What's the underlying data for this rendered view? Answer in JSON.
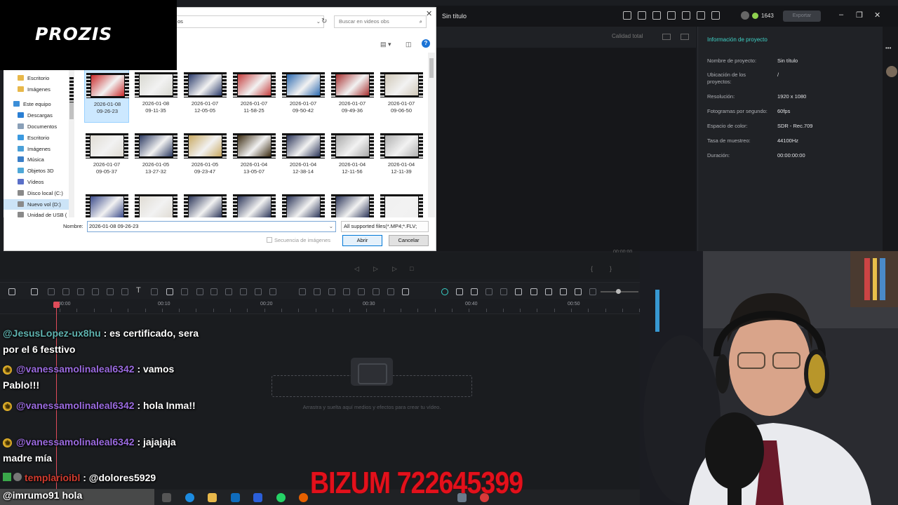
{
  "logo": {
    "text": "PROZIS"
  },
  "editor": {
    "title": "Sin título",
    "credits": "1643",
    "export_label": "Exportar",
    "quality_label": "Calidad total",
    "timecode": "00:00:00",
    "project_panel": {
      "title": "Información de proyecto",
      "rows": [
        {
          "key": "Nombre de proyecto:",
          "value": "Sin título"
        },
        {
          "key": "Ubicación de los proyectos:",
          "value": "/"
        },
        {
          "key": "Resolución:",
          "value": "1920 x 1080"
        },
        {
          "key": "Fotogramas por segundo:",
          "value": "60fps"
        },
        {
          "key": "Espacio de color:",
          "value": "SDR - Rec.709"
        },
        {
          "key": "Tasa de muestreo:",
          "value": "44100Hz"
        },
        {
          "key": "Duración:",
          "value": "00:00:00:00"
        }
      ]
    },
    "ruler_ticks": [
      "00:00",
      "00:10",
      "00:20",
      "00:30",
      "00:40",
      "00:50"
    ],
    "drop_hint": "Arrastra y suelta aquí medios y efectos para crear tu vídeo."
  },
  "dialog": {
    "path_fragment": "os",
    "search_placeholder": "Buscar en videos obs",
    "nav_items": [
      {
        "label": "Escritorio",
        "icon": "folder-icon",
        "color": "#e8b84a"
      },
      {
        "label": "Imágenes",
        "icon": "folder-icon",
        "color": "#e8b84a"
      },
      {
        "label": "Este equipo",
        "icon": "computer-icon",
        "color": "#3b8ed8"
      },
      {
        "label": "Descargas",
        "icon": "download-icon",
        "color": "#2a7fd4"
      },
      {
        "label": "Documentos",
        "icon": "document-icon",
        "color": "#8aa0b8"
      },
      {
        "label": "Escritorio",
        "icon": "desktop-icon",
        "color": "#3b9ae0"
      },
      {
        "label": "Imágenes",
        "icon": "pictures-icon",
        "color": "#4aa0d8"
      },
      {
        "label": "Música",
        "icon": "music-icon",
        "color": "#3a7fc8"
      },
      {
        "label": "Objetos 3D",
        "icon": "cube-icon",
        "color": "#4fa8d8"
      },
      {
        "label": "Vídeos",
        "icon": "video-icon",
        "color": "#5a6fc8"
      },
      {
        "label": "Disco local (C:)",
        "icon": "drive-icon",
        "color": "#8a8a8a"
      },
      {
        "label": "Nuevo vol (D:)",
        "icon": "drive-icon",
        "color": "#8a8a8a"
      },
      {
        "label": "Unidad de USB (",
        "icon": "usb-icon",
        "color": "#8a8a8a"
      }
    ],
    "files": [
      {
        "name": "2026-01-08\n09-26-23",
        "tone": "#c92a2a"
      },
      {
        "name": "2026-01-08\n09-11-35",
        "tone": "#d8d8d0"
      },
      {
        "name": "2026-01-07\n12-05-05",
        "tone": "#2a3a6a"
      },
      {
        "name": "2026-01-07\n11-58-25",
        "tone": "#c43c3c"
      },
      {
        "name": "2026-01-07\n09-50-42",
        "tone": "#2c6ab0"
      },
      {
        "name": "2026-01-07\n09-49-36",
        "tone": "#a83030"
      },
      {
        "name": "2026-01-07\n09-06-50",
        "tone": "#d0c8b8"
      },
      {
        "name": "2026-01-07\n09-05-37",
        "tone": "#e0dcd4"
      },
      {
        "name": "2026-01-05\n13-27-32",
        "tone": "#2a3860"
      },
      {
        "name": "2026-01-05\n09-23-47",
        "tone": "#c8a860"
      },
      {
        "name": "2026-01-04\n13-05-07",
        "tone": "#3a2a10"
      },
      {
        "name": "2026-01-04\n12-38-14",
        "tone": "#2a3458"
      },
      {
        "name": "2026-01-04\n12-11-56",
        "tone": "#a8a8a8"
      },
      {
        "name": "2026-01-04\n12-11-39",
        "tone": "#b0b0b0"
      },
      {
        "name": "",
        "tone": "#3a4a8a"
      },
      {
        "name": "",
        "tone": "#e0dcd4"
      },
      {
        "name": "",
        "tone": "#2a3458"
      },
      {
        "name": "",
        "tone": "#2a3458"
      },
      {
        "name": "",
        "tone": "#2a3458"
      },
      {
        "name": "",
        "tone": "#2a3458"
      },
      {
        "name": "",
        "tone": "#f0f0f0"
      }
    ],
    "name_label": "Nombre:",
    "name_value": "2026-01-08 09-26-23",
    "type_value": "All supported files(*.MP4;*.FLV;",
    "sequence_label": "Secuencia de imágenes",
    "open_label": "Abrir",
    "cancel_label": "Cancelar"
  },
  "chat": {
    "messages": [
      {
        "user": "@JesusLopez-ux8hu",
        "text": ": es certificado, sera por el 6 festtivo",
        "star": false,
        "color": "teal"
      },
      {
        "user": "@vanessamolinaleal6342",
        "text": ": vamos Pablo!!!",
        "star": true,
        "color": "purple"
      },
      {
        "user": "@vanessamolinaleal6342",
        "text": ": hola Inma!!",
        "star": true,
        "color": "purple"
      },
      {
        "user": "@vanessamolinaleal6342",
        "text": ": jajajaja madre mía",
        "star": true,
        "color": "purple"
      },
      {
        "user": "templarioibl",
        "text": ": @dolores5929",
        "star": false,
        "color": "red"
      },
      {
        "user": "@imrumo91",
        "text": " hola",
        "star": false,
        "color": "white"
      }
    ]
  },
  "bizum": {
    "text": "BIZUM 722645399"
  }
}
